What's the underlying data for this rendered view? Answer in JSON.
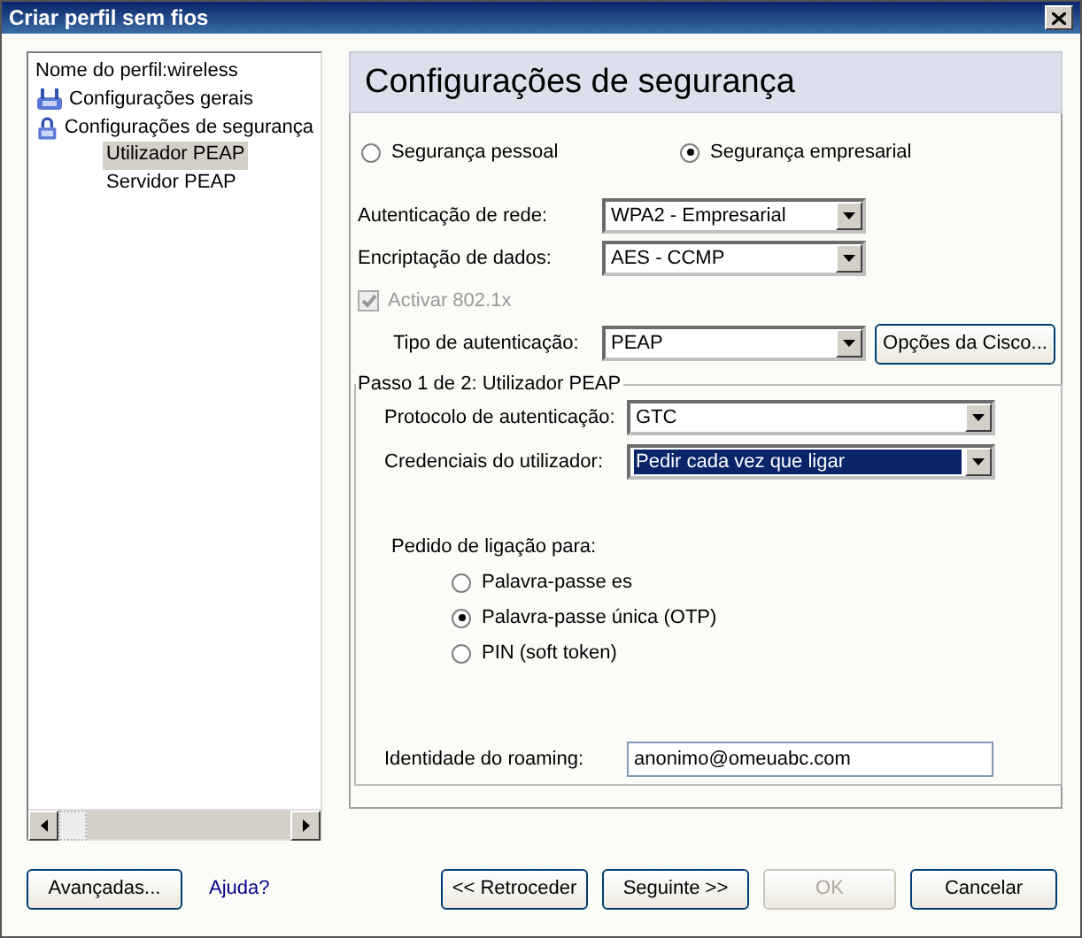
{
  "window": {
    "title": "Criar perfil sem fios"
  },
  "tree": [
    {
      "kind": "text",
      "label": "Nome do perfil:wireless"
    },
    {
      "kind": "network",
      "label": "Configurações gerais"
    },
    {
      "kind": "lock",
      "label": "Configurações de segurança",
      "children": [
        {
          "label": "Utilizador PEAP",
          "selected": true
        },
        {
          "label": "Servidor PEAP",
          "selected": false
        }
      ]
    }
  ],
  "header": "Configurações de segurança",
  "security_mode": [
    {
      "label": "Segurança pessoal",
      "selected": false
    },
    {
      "label": "Segurança empresarial",
      "selected": true
    }
  ],
  "network_auth": {
    "label": "Autenticação de rede:",
    "value": "WPA2 - Empresarial"
  },
  "encryption": {
    "label": "Encriptação de dados:",
    "value": "AES - CCMP"
  },
  "activate_8021x": {
    "label": "Activar 802.1x",
    "checked": true,
    "disabled": true
  },
  "auth_type": {
    "label": "Tipo de autenticação:",
    "value": "PEAP"
  },
  "cisco_button": "Opções da Cisco...",
  "step_group": {
    "title": "Passo 1 de 2: Utilizador PEAP",
    "protocol": {
      "label": "Protocolo de autenticação:",
      "value": "GTC",
      "focused": false
    },
    "credentials": {
      "label": "Credenciais do utilizador:",
      "value": "Pedir cada vez que ligar",
      "focused": true
    },
    "prompt_label": "Pedido de ligação para:",
    "prompt_options": [
      {
        "label": "Palavra-passe es",
        "selected": false
      },
      {
        "label": "Palavra-passe única (OTP)",
        "selected": true
      },
      {
        "label": "PIN (soft token)",
        "selected": false
      }
    ],
    "roaming": {
      "label": "Identidade do roaming:",
      "value": "anonimo@omeuabc.com"
    }
  },
  "footer": {
    "advanced_button": "Avançadas...",
    "help_link": "Ajuda?",
    "buttons": [
      {
        "label": "<< Retroceder",
        "disabled": false
      },
      {
        "label": "Seguinte >>",
        "disabled": false
      },
      {
        "label": "OK",
        "disabled": true
      },
      {
        "label": "Cancelar",
        "disabled": false
      }
    ]
  }
}
